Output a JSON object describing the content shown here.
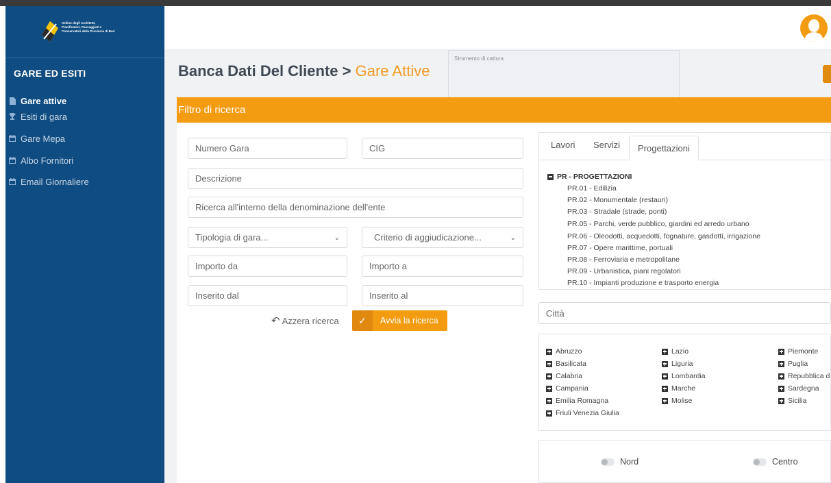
{
  "brand": {
    "line1": "Ordine degli Architetti,",
    "line2": "Pianificatori, Paesaggisti e",
    "line3": "Conservatori della Provincia di Bari"
  },
  "sidebar": {
    "title": "GARE ED ESITI",
    "items": [
      {
        "label": "Gare attive",
        "icon": "file-icon",
        "active": true
      },
      {
        "label": "Esiti di gara",
        "icon": "trophy-icon",
        "active": false
      },
      {
        "label": "Gare Mepa",
        "icon": "calendar-icon",
        "active": false
      },
      {
        "label": "Albo Fornitori",
        "icon": "calendar-icon",
        "active": false
      },
      {
        "label": "Email Giornaliere",
        "icon": "calendar-icon",
        "active": false
      }
    ]
  },
  "page": {
    "title_main": "Banca Dati Del Cliente",
    "title_sep": ">",
    "title_sub": "Gare Attive"
  },
  "snip_tool": {
    "label": "Strumento di cattura"
  },
  "filter": {
    "title": "Filtro di ricerca",
    "fields": {
      "numero_gara": "Numero Gara",
      "cig": "CIG",
      "descrizione": "Descrizione",
      "ente": "Ricerca all'interno della denominazione dell'ente",
      "tipologia": "Tipologia di gara...",
      "criterio": "Criterio di aggiudicazione...",
      "importo_da": "Importo da",
      "importo_a": "Importo a",
      "inserito_dal": "Inserito dal",
      "inserito_al": "Inserito al"
    },
    "reset_label": "Azzera ricerca",
    "search_label": "Avvia la ricerca"
  },
  "tabs": [
    "Lavori",
    "Servizi",
    "Progettazioni"
  ],
  "tabs_active": "Progettazioni",
  "tree": {
    "title": "PR - PROGETTAZIONI",
    "items": [
      "PR.01 - Edilizia",
      "PR.02 - Monumentale (restauri)",
      "PR.03 - Stradale (strade, ponti)",
      "PR.05 - Parchi, verde pubblico, giardini ed arredo urbano",
      "PR.06 - Oleodotti, acquedotti, fognature, gasdotti, irrigazione",
      "PR.07 - Opere marittime, portuali",
      "PR.08 - Ferroviaria e metropolitane",
      "PR.09 - Urbanistica, piani regolatori",
      "PR.10 - Impianti produzione e trasporto energia"
    ]
  },
  "citta_placeholder": "Città",
  "regions": {
    "col1": [
      "Abruzzo",
      "Basilicata",
      "Calabria",
      "Campania",
      "Emilia Romagna",
      "Friuli Venezia Giulia"
    ],
    "col2": [
      "Lazio",
      "Liguria",
      "Lombardia",
      "Marche",
      "Molise"
    ],
    "col3": [
      "Piemonte",
      "Puglia",
      "Repubblica d",
      "Sardegna",
      "Sicilia"
    ]
  },
  "zones": [
    "Nord",
    "Centro"
  ]
}
